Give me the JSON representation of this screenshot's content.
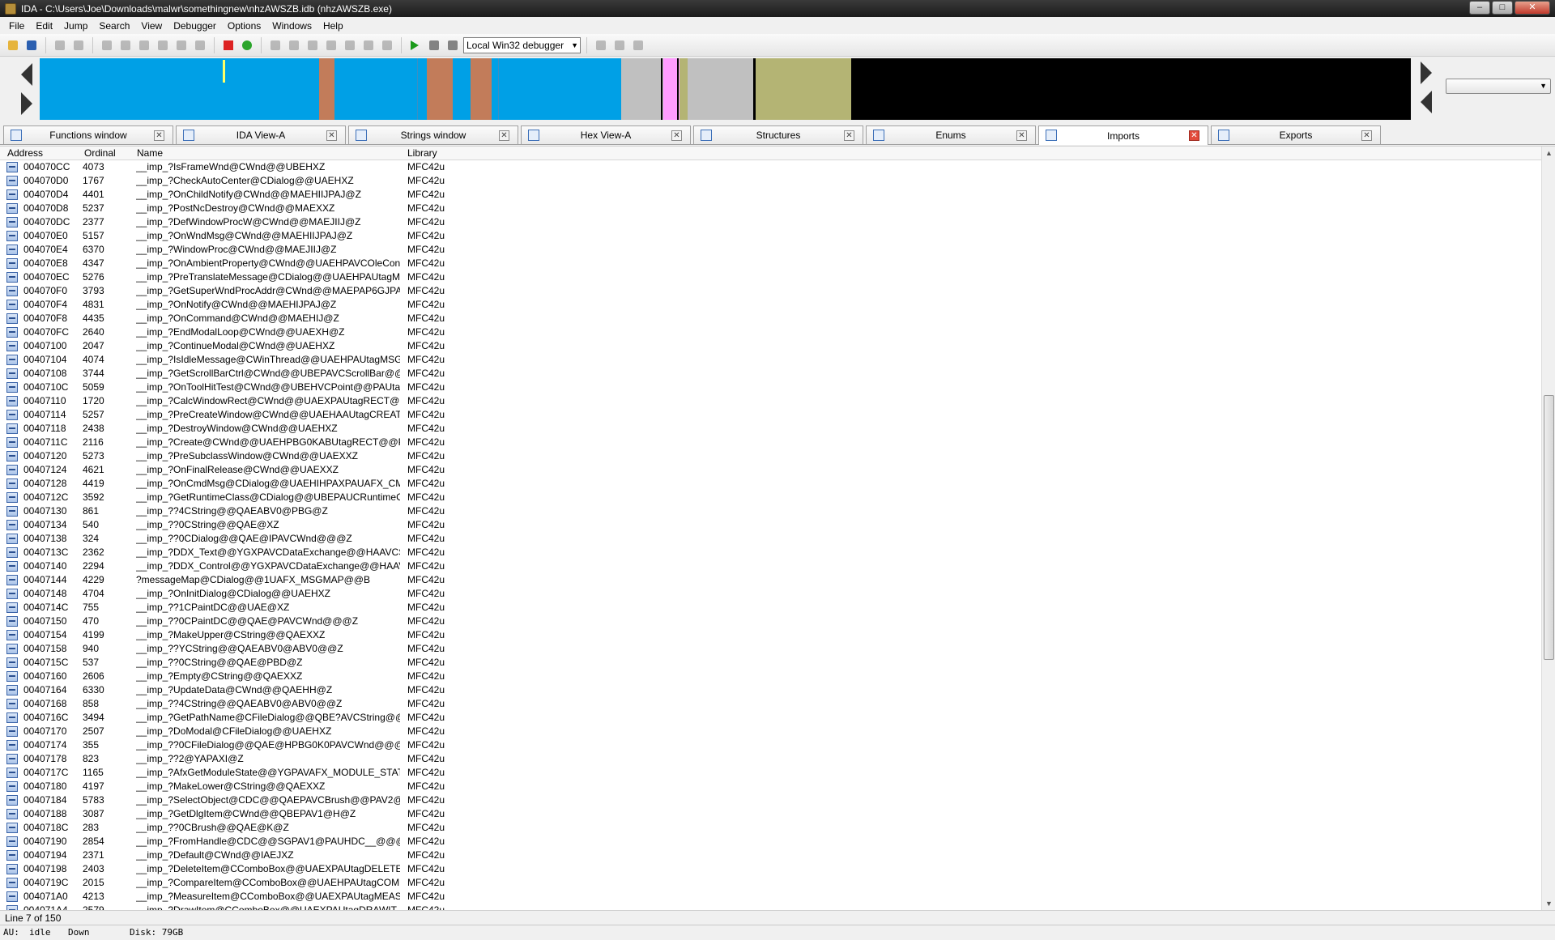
{
  "window": {
    "title": "IDA - C:\\Users\\Joe\\Downloads\\malwr\\somethingnew\\nhzAWSZB.idb (nhzAWSZB.exe)"
  },
  "menu": [
    "File",
    "Edit",
    "Jump",
    "Search",
    "View",
    "Debugger",
    "Options",
    "Windows",
    "Help"
  ],
  "toolbar": {
    "debugger_select": "Local Win32 debugger"
  },
  "navigation_band": {
    "colors": {
      "library": "#00a0e6",
      "regular": "#c27c5a",
      "external": "#ff9cff",
      "unexplored": "#b4b474",
      "data": "#c0c0c0",
      "black": "#000000",
      "marker": "#ffff66"
    }
  },
  "tabs": [
    {
      "label": "Functions window",
      "icon": "functions-icon"
    },
    {
      "label": "IDA View-A",
      "icon": "ida-view-icon"
    },
    {
      "label": "Strings window",
      "icon": "strings-icon"
    },
    {
      "label": "Hex View-A",
      "icon": "hex-icon"
    },
    {
      "label": "Structures",
      "icon": "structures-icon"
    },
    {
      "label": "Enums",
      "icon": "enums-icon"
    },
    {
      "label": "Imports",
      "icon": "imports-icon",
      "active": true
    },
    {
      "label": "Exports",
      "icon": "exports-icon"
    }
  ],
  "table": {
    "headers": {
      "address": "Address",
      "ordinal": "Ordinal",
      "name": "Name",
      "library": "Library"
    },
    "rows": [
      [
        "004070CC",
        "4073",
        "__imp_?IsFrameWnd@CWnd@@UBEHXZ",
        "MFC42u"
      ],
      [
        "004070D0",
        "1767",
        "__imp_?CheckAutoCenter@CDialog@@UAEHXZ",
        "MFC42u"
      ],
      [
        "004070D4",
        "4401",
        "__imp_?OnChildNotify@CWnd@@MAEHIIJPAJ@Z",
        "MFC42u"
      ],
      [
        "004070D8",
        "5237",
        "__imp_?PostNcDestroy@CWnd@@MAEXXZ",
        "MFC42u"
      ],
      [
        "004070DC",
        "2377",
        "__imp_?DefWindowProcW@CWnd@@MAEJIIJ@Z",
        "MFC42u"
      ],
      [
        "004070E0",
        "5157",
        "__imp_?OnWndMsg@CWnd@@MAEHIIJPAJ@Z",
        "MFC42u"
      ],
      [
        "004070E4",
        "6370",
        "__imp_?WindowProc@CWnd@@MAEJIIJ@Z",
        "MFC42u"
      ],
      [
        "004070E8",
        "4347",
        "__imp_?OnAmbientProperty@CWnd@@UAEHPAVCOleCont...",
        "MFC42u"
      ],
      [
        "004070EC",
        "5276",
        "__imp_?PreTranslateMessage@CDialog@@UAEHPAUtagMS...",
        "MFC42u"
      ],
      [
        "004070F0",
        "3793",
        "__imp_?GetSuperWndProcAddr@CWnd@@MAEPAP6GJPAU...",
        "MFC42u"
      ],
      [
        "004070F4",
        "4831",
        "__imp_?OnNotify@CWnd@@MAEHIJPAJ@Z",
        "MFC42u"
      ],
      [
        "004070F8",
        "4435",
        "__imp_?OnCommand@CWnd@@MAEHIJ@Z",
        "MFC42u"
      ],
      [
        "004070FC",
        "2640",
        "__imp_?EndModalLoop@CWnd@@UAEXH@Z",
        "MFC42u"
      ],
      [
        "00407100",
        "2047",
        "__imp_?ContinueModal@CWnd@@UAEHXZ",
        "MFC42u"
      ],
      [
        "00407104",
        "4074",
        "__imp_?IsIdleMessage@CWinThread@@UAEHPAUtagMSG@...",
        "MFC42u"
      ],
      [
        "00407108",
        "3744",
        "__imp_?GetScrollBarCtrl@CWnd@@UBEPAVCScrollBar@@H...",
        "MFC42u"
      ],
      [
        "0040710C",
        "5059",
        "__imp_?OnToolHitTest@CWnd@@UBEHVCPoint@@PAUtag...",
        "MFC42u"
      ],
      [
        "00407110",
        "1720",
        "__imp_?CalcWindowRect@CWnd@@UAEXPAUtagRECT@@I...",
        "MFC42u"
      ],
      [
        "00407114",
        "5257",
        "__imp_?PreCreateWindow@CWnd@@UAEHAAUtagCREATE...",
        "MFC42u"
      ],
      [
        "00407118",
        "2438",
        "__imp_?DestroyWindow@CWnd@@UAEHXZ",
        "MFC42u"
      ],
      [
        "0040711C",
        "2116",
        "__imp_?Create@CWnd@@UAEHPBG0KABUtagRECT@@PAV...",
        "MFC42u"
      ],
      [
        "00407120",
        "5273",
        "__imp_?PreSubclassWindow@CWnd@@UAEXXZ",
        "MFC42u"
      ],
      [
        "00407124",
        "4621",
        "__imp_?OnFinalRelease@CWnd@@UAEXXZ",
        "MFC42u"
      ],
      [
        "00407128",
        "4419",
        "__imp_?OnCmdMsg@CDialog@@UAEHIHPAXPAUAFX_CM...",
        "MFC42u"
      ],
      [
        "0040712C",
        "3592",
        "__imp_?GetRuntimeClass@CDialog@@UBEPAUCRuntimeCla...",
        "MFC42u"
      ],
      [
        "00407130",
        "861",
        "__imp_??4CString@@QAEABV0@PBG@Z",
        "MFC42u"
      ],
      [
        "00407134",
        "540",
        "__imp_??0CString@@QAE@XZ",
        "MFC42u"
      ],
      [
        "00407138",
        "324",
        "__imp_??0CDialog@@QAE@IPAVCWnd@@@Z",
        "MFC42u"
      ],
      [
        "0040713C",
        "2362",
        "__imp_?DDX_Text@@YGXPAVCDataExchange@@HAAVCStri...",
        "MFC42u"
      ],
      [
        "00407140",
        "2294",
        "__imp_?DDX_Control@@YGXPAVCDataExchange@@HAAVC...",
        "MFC42u"
      ],
      [
        "00407144",
        "4229",
        "?messageMap@CDialog@@1UAFX_MSGMAP@@B",
        "MFC42u"
      ],
      [
        "00407148",
        "4704",
        "__imp_?OnInitDialog@CDialog@@UAEHXZ",
        "MFC42u"
      ],
      [
        "0040714C",
        "755",
        "__imp_??1CPaintDC@@UAE@XZ",
        "MFC42u"
      ],
      [
        "00407150",
        "470",
        "__imp_??0CPaintDC@@QAE@PAVCWnd@@@Z",
        "MFC42u"
      ],
      [
        "00407154",
        "4199",
        "__imp_?MakeUpper@CString@@QAEXXZ",
        "MFC42u"
      ],
      [
        "00407158",
        "940",
        "__imp_??YCString@@QAEABV0@ABV0@@Z",
        "MFC42u"
      ],
      [
        "0040715C",
        "537",
        "__imp_??0CString@@QAE@PBD@Z",
        "MFC42u"
      ],
      [
        "00407160",
        "2606",
        "__imp_?Empty@CString@@QAEXXZ",
        "MFC42u"
      ],
      [
        "00407164",
        "6330",
        "__imp_?UpdateData@CWnd@@QAEHH@Z",
        "MFC42u"
      ],
      [
        "00407168",
        "858",
        "__imp_??4CString@@QAEABV0@ABV0@@Z",
        "MFC42u"
      ],
      [
        "0040716C",
        "3494",
        "__imp_?GetPathName@CFileDialog@@QBE?AVCString@@XZ",
        "MFC42u"
      ],
      [
        "00407170",
        "2507",
        "__imp_?DoModal@CFileDialog@@UAEHXZ",
        "MFC42u"
      ],
      [
        "00407174",
        "355",
        "__imp_??0CFileDialog@@QAE@HPBG0K0PAVCWnd@@@Z",
        "MFC42u"
      ],
      [
        "00407178",
        "823",
        "__imp_??2@YAPAXI@Z",
        "MFC42u"
      ],
      [
        "0040717C",
        "1165",
        "__imp_?AfxGetModuleState@@YGPAVAFX_MODULE_STATE...",
        "MFC42u"
      ],
      [
        "00407180",
        "4197",
        "__imp_?MakeLower@CString@@QAEXXZ",
        "MFC42u"
      ],
      [
        "00407184",
        "5783",
        "__imp_?SelectObject@CDC@@QAEPAVCBrush@@PAV2@@Z",
        "MFC42u"
      ],
      [
        "00407188",
        "3087",
        "__imp_?GetDlgItem@CWnd@@QBEPAV1@H@Z",
        "MFC42u"
      ],
      [
        "0040718C",
        "283",
        "__imp_??0CBrush@@QAE@K@Z",
        "MFC42u"
      ],
      [
        "00407190",
        "2854",
        "__imp_?FromHandle@CDC@@SGPAV1@PAUHDC__@@@Z",
        "MFC42u"
      ],
      [
        "00407194",
        "2371",
        "__imp_?Default@CWnd@@IAEJXZ",
        "MFC42u"
      ],
      [
        "00407198",
        "2403",
        "__imp_?DeleteItem@CComboBox@@UAEXPAUtagDELETEIT...",
        "MFC42u"
      ],
      [
        "0040719C",
        "2015",
        "__imp_?CompareItem@CComboBox@@UAEHPAUtagCOMP...",
        "MFC42u"
      ],
      [
        "004071A0",
        "4213",
        "__imp_?MeasureItem@CComboBox@@UAEXPAUtagMEASU...",
        "MFC42u"
      ],
      [
        "004071A4",
        "2579",
        "__imp_?DrawItem@CComboBox@@UAEXPAUtagDRAWIT...",
        "MFC42u"
      ]
    ]
  },
  "status": {
    "line": "Line 7 of 150",
    "au_label": "AU:",
    "au_state": "idle",
    "direction": "Down",
    "disk": "Disk: 79GB"
  }
}
